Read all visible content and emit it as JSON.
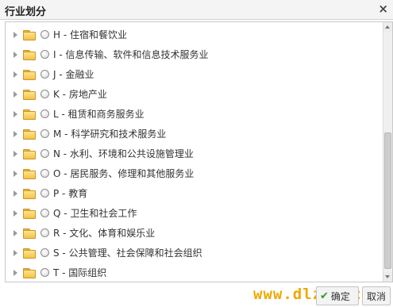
{
  "dialog": {
    "title": "行业划分",
    "close_label": "×"
  },
  "tree": {
    "items": [
      {
        "label": "H - 住宿和餐饮业"
      },
      {
        "label": "I - 信息传输、软件和信息技术服务业"
      },
      {
        "label": "J - 金融业"
      },
      {
        "label": "K - 房地产业"
      },
      {
        "label": "L - 租赁和商务服务业"
      },
      {
        "label": "M - 科学研究和技术服务业"
      },
      {
        "label": "N - 水利、环境和公共设施管理业"
      },
      {
        "label": "O - 居民服务、修理和其他服务业"
      },
      {
        "label": "P - 教育"
      },
      {
        "label": "Q - 卫生和社会工作"
      },
      {
        "label": "R - 文化、体育和娱乐业"
      },
      {
        "label": "S - 公共管理、社会保障和社会组织"
      },
      {
        "label": "T - 国际组织"
      }
    ]
  },
  "footer": {
    "watermark": "www.dlztb.com",
    "confirm_label": "确定",
    "cancel_label": "取消"
  },
  "colors": {
    "watermark": "#f0a800",
    "confirm_check": "#2f9a2f",
    "folder": "#f3c34a"
  }
}
